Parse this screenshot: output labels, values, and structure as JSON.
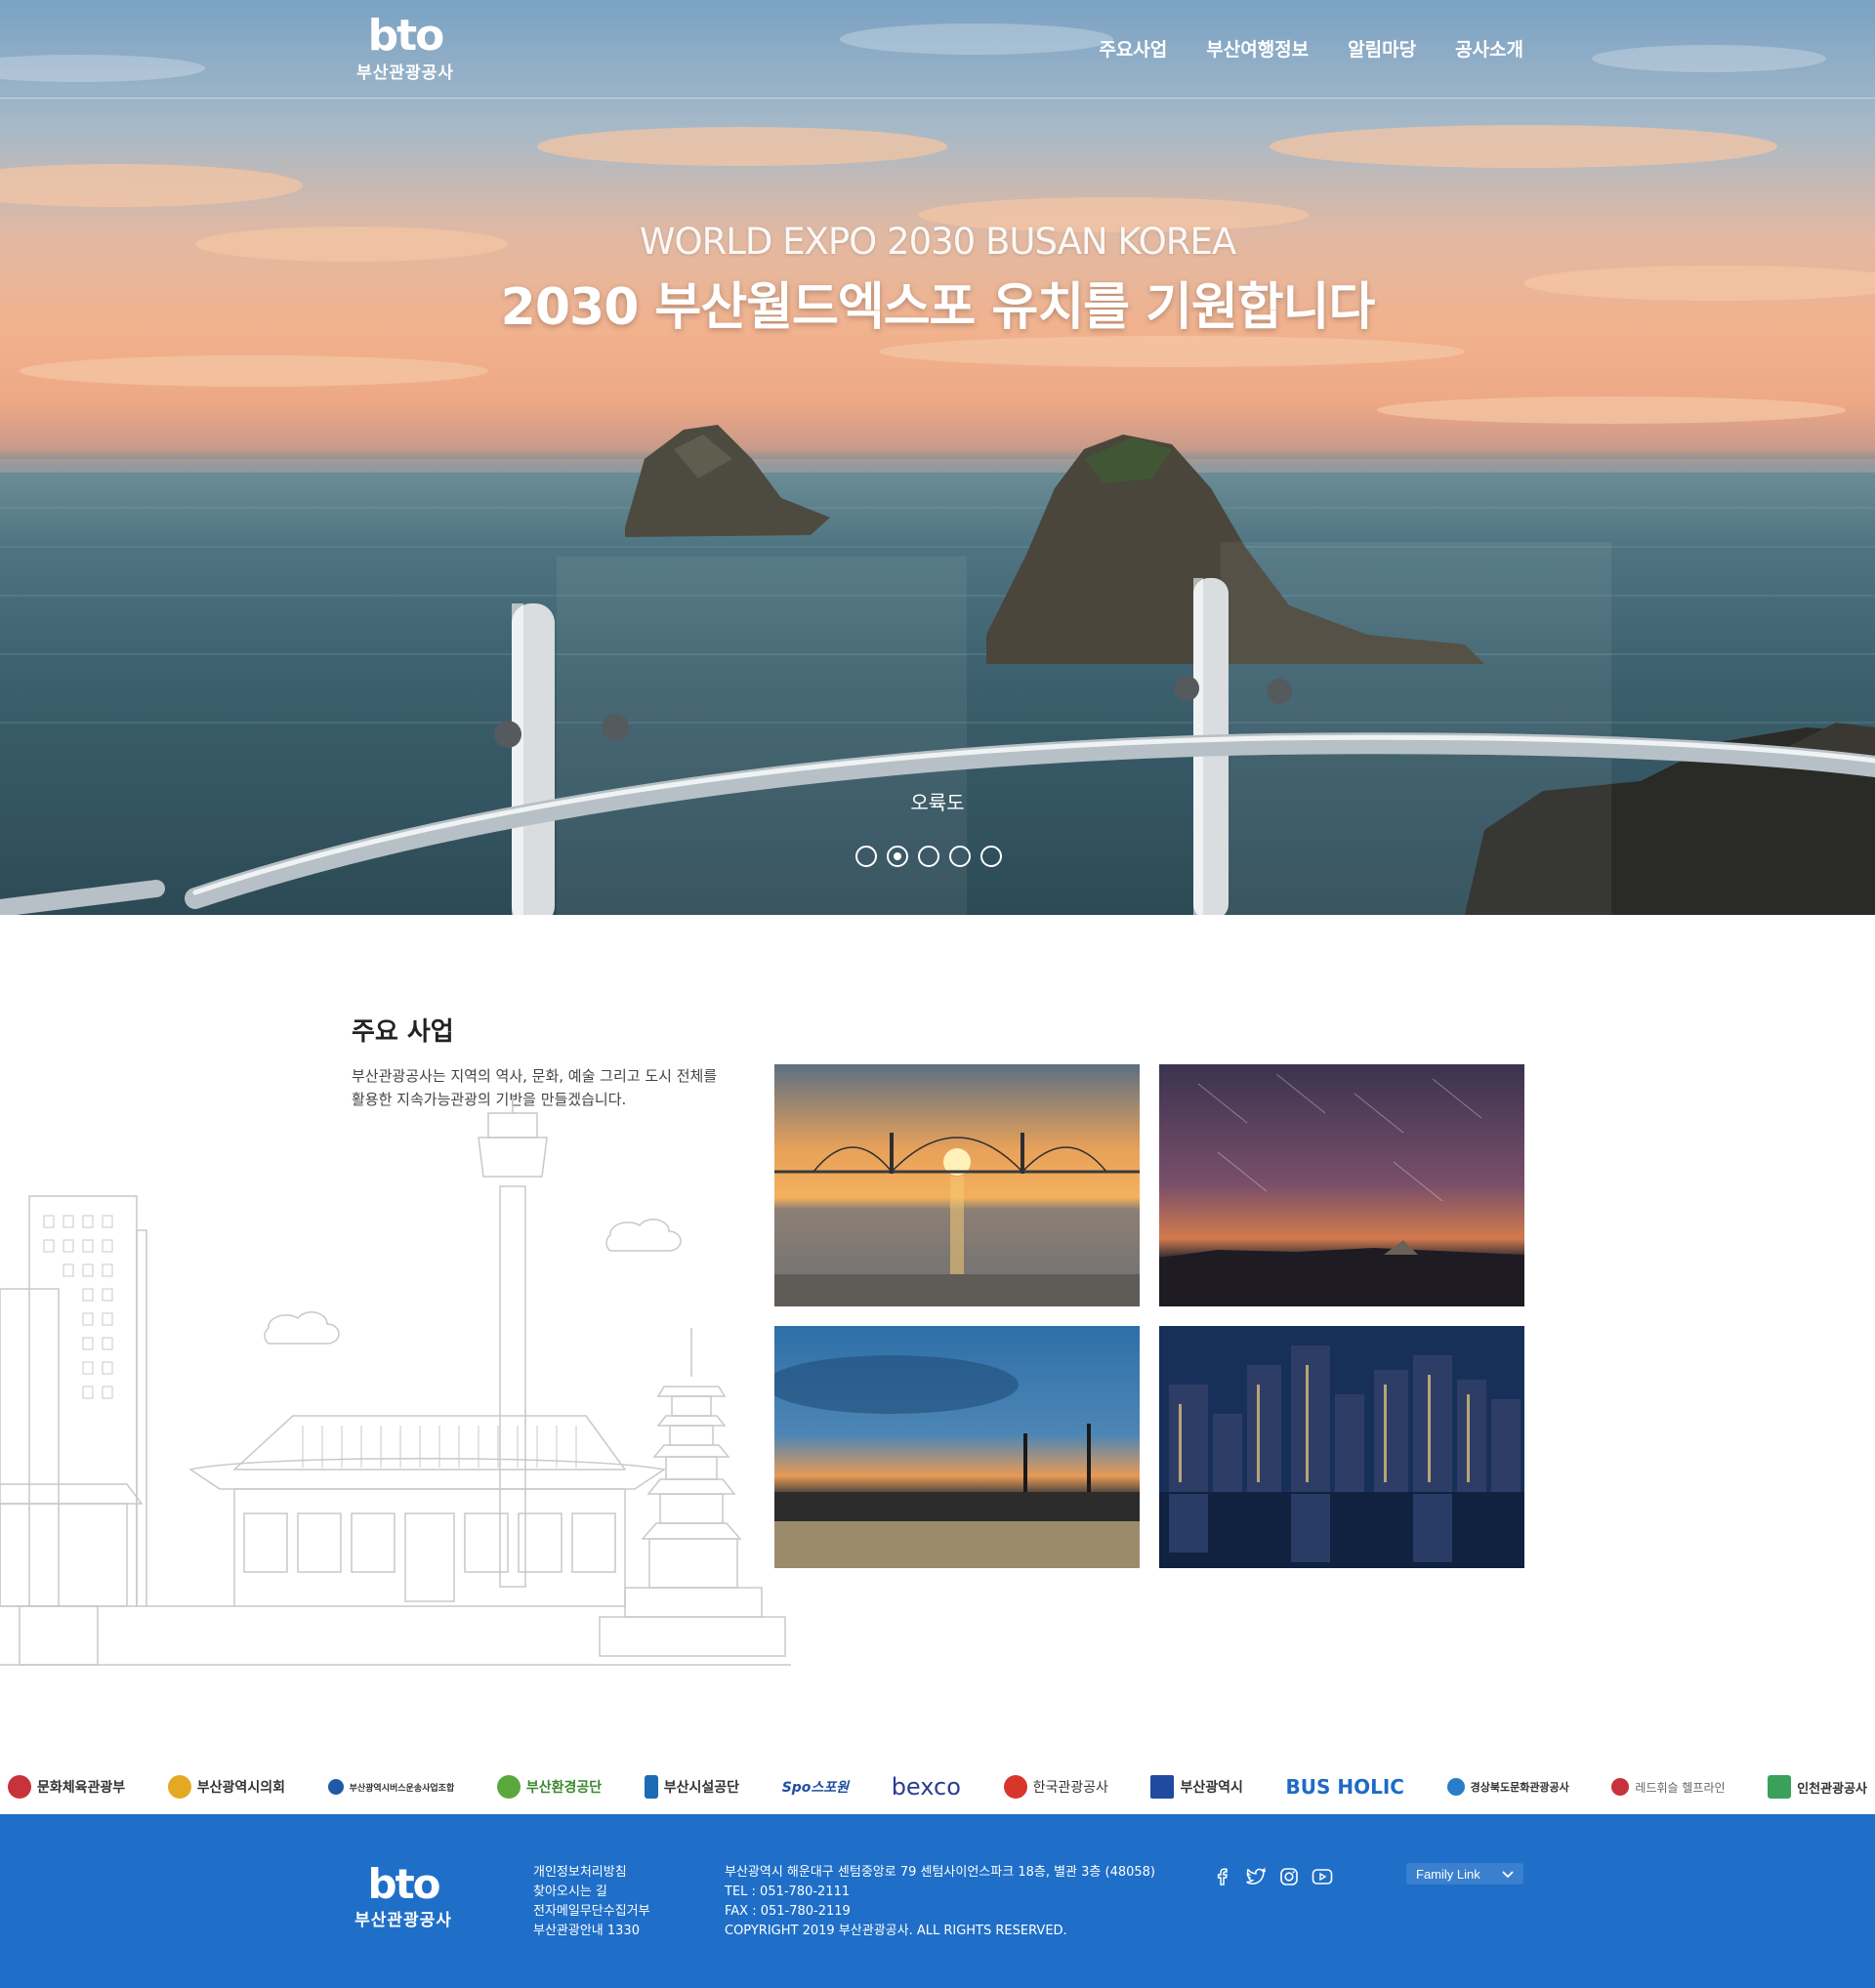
{
  "header": {
    "logo_mark": "bto",
    "logo_name": "부산관광공사",
    "nav": [
      "주요사업",
      "부산여행정보",
      "알림마당",
      "공사소개"
    ]
  },
  "hero": {
    "subtitle": "WORLD EXPO 2030 BUSAN KOREA",
    "title": "2030 부산월드엑스포 유치를 기원합니다",
    "caption": "오륙도",
    "slide_count": 5,
    "active_slide": 2
  },
  "business": {
    "title": "주요 사업",
    "desc_line1": "부산관광공사는 지역의 역사, 문화, 예술 그리고 도시 전체를",
    "desc_line2": "활용한 지속가능관광의 기반을 만들겠습니다."
  },
  "partners": [
    {
      "label": "문화체육관광부",
      "color": "#c8323a"
    },
    {
      "label": "부산광역시의회",
      "color": "#e5a823"
    },
    {
      "label": "부산광역시버스운송사업조합",
      "color": "#1f5aa8"
    },
    {
      "label": "부산환경공단",
      "color": "#5aa83c"
    },
    {
      "label": "부산시설공단",
      "color": "#1d6ab5"
    },
    {
      "label": "Spo스포원",
      "color": "#1f4fa0"
    },
    {
      "label": "bexco",
      "color": "#2a3d8f"
    },
    {
      "label": "한국관광공사",
      "color": "#d8352b"
    },
    {
      "label": "부산광역시",
      "color": "#1f4aa0"
    },
    {
      "label": "BUS HOLIC",
      "color": "#1f6ac8"
    },
    {
      "label": "경상북도문화관광공사",
      "color": "#2a7bc8"
    },
    {
      "label": "레드휘슬 헬프라인",
      "color": "#c8323a"
    },
    {
      "label": "인천관광공사",
      "color": "#3aa05a"
    }
  ],
  "footer": {
    "logo_mark": "bto",
    "logo_name": "부산관광공사",
    "links": [
      "개인정보처리방침",
      "찾아오시는 길",
      "전자메일무단수집거부",
      "부산관광안내 1330"
    ],
    "address": "부산광역시 해운대구 센텀중앙로 79 센텀사이언스파크 18층, 별관 3층 (48058)",
    "tel": "TEL : 051-780-2111",
    "fax": "FAX : 051-780-2119",
    "copyright": "COPYRIGHT 2019 부산관광공사. ALL RIGHTS RESERVED.",
    "sns": [
      "facebook-icon",
      "twitter-icon",
      "instagram-icon",
      "youtube-icon"
    ],
    "family_link": "Family Link"
  },
  "colors": {
    "footer_bg": "#1f6fc8",
    "text_dark": "#222222"
  }
}
